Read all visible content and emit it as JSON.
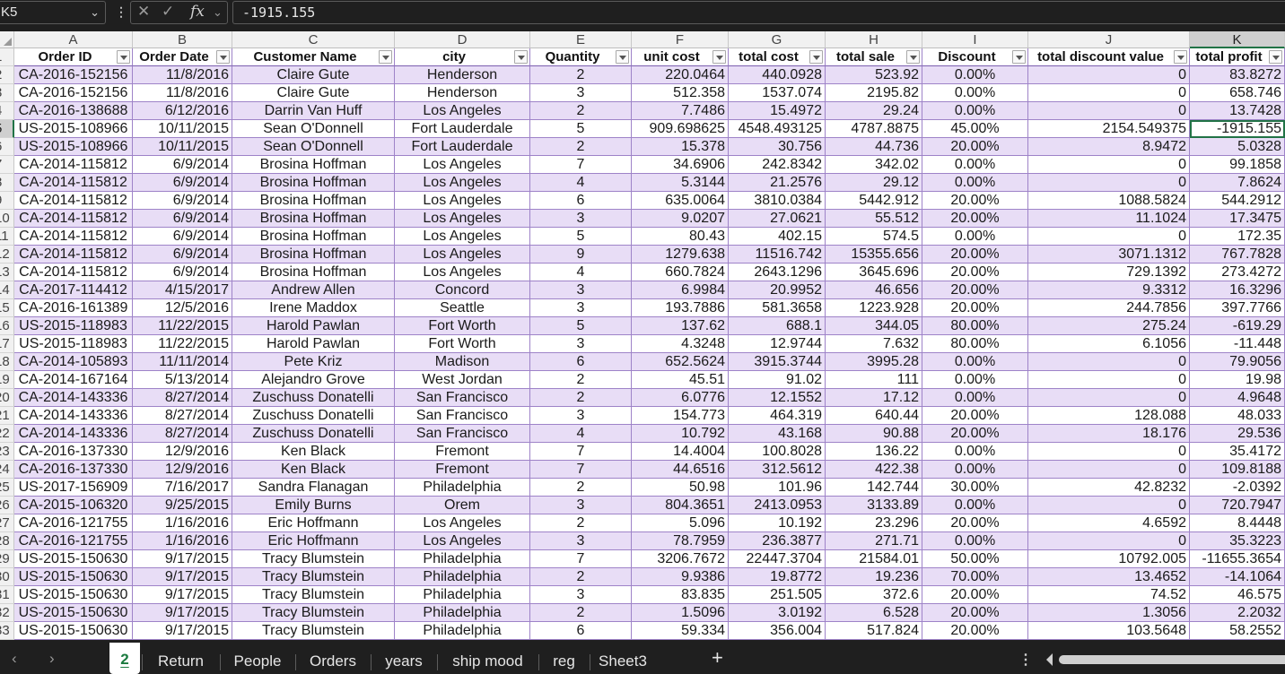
{
  "formula_bar": {
    "name_box": "K5",
    "menu_glyph": "⋮",
    "cancel_glyph": "✕",
    "enter_glyph": "✓",
    "fx_glyph": "fx",
    "formula": "-1915.155"
  },
  "columns": [
    "A",
    "B",
    "C",
    "D",
    "E",
    "F",
    "G",
    "H",
    "I",
    "J",
    "K"
  ],
  "selected_column": "K",
  "header_row_number": "1",
  "headers": [
    "Order ID",
    "Order Date",
    "Customer Name",
    "city",
    "Quantity",
    "unit cost",
    "total cost",
    "total sale",
    "Discount",
    "total discount value",
    "total profit"
  ],
  "rows": [
    {
      "n": "2",
      "v": [
        "CA-2016-152156",
        "11/8/2016",
        "Claire Gute",
        "Henderson",
        "2",
        "220.0464",
        "440.0928",
        "523.92",
        "0.00%",
        "0",
        "83.8272"
      ]
    },
    {
      "n": "3",
      "v": [
        "CA-2016-152156",
        "11/8/2016",
        "Claire Gute",
        "Henderson",
        "3",
        "512.358",
        "1537.074",
        "2195.82",
        "0.00%",
        "0",
        "658.746"
      ]
    },
    {
      "n": "4",
      "v": [
        "CA-2016-138688",
        "6/12/2016",
        "Darrin Van Huff",
        "Los Angeles",
        "2",
        "7.7486",
        "15.4972",
        "29.24",
        "0.00%",
        "0",
        "13.7428"
      ]
    },
    {
      "n": "5",
      "v": [
        "US-2015-108966",
        "10/11/2015",
        "Sean O'Donnell",
        "Fort Lauderdale",
        "5",
        "909.698625",
        "4548.493125",
        "4787.8875",
        "45.00%",
        "2154.549375",
        "-1915.155"
      ]
    },
    {
      "n": "6",
      "v": [
        "US-2015-108966",
        "10/11/2015",
        "Sean O'Donnell",
        "Fort Lauderdale",
        "2",
        "15.378",
        "30.756",
        "44.736",
        "20.00%",
        "8.9472",
        "5.0328"
      ]
    },
    {
      "n": "7",
      "v": [
        "CA-2014-115812",
        "6/9/2014",
        "Brosina Hoffman",
        "Los Angeles",
        "7",
        "34.6906",
        "242.8342",
        "342.02",
        "0.00%",
        "0",
        "99.1858"
      ]
    },
    {
      "n": "8",
      "v": [
        "CA-2014-115812",
        "6/9/2014",
        "Brosina Hoffman",
        "Los Angeles",
        "4",
        "5.3144",
        "21.2576",
        "29.12",
        "0.00%",
        "0",
        "7.8624"
      ]
    },
    {
      "n": "9",
      "v": [
        "CA-2014-115812",
        "6/9/2014",
        "Brosina Hoffman",
        "Los Angeles",
        "6",
        "635.0064",
        "3810.0384",
        "5442.912",
        "20.00%",
        "1088.5824",
        "544.2912"
      ]
    },
    {
      "n": "10",
      "v": [
        "CA-2014-115812",
        "6/9/2014",
        "Brosina Hoffman",
        "Los Angeles",
        "3",
        "9.0207",
        "27.0621",
        "55.512",
        "20.00%",
        "11.1024",
        "17.3475"
      ]
    },
    {
      "n": "11",
      "v": [
        "CA-2014-115812",
        "6/9/2014",
        "Brosina Hoffman",
        "Los Angeles",
        "5",
        "80.43",
        "402.15",
        "574.5",
        "0.00%",
        "0",
        "172.35"
      ]
    },
    {
      "n": "12",
      "v": [
        "CA-2014-115812",
        "6/9/2014",
        "Brosina Hoffman",
        "Los Angeles",
        "9",
        "1279.638",
        "11516.742",
        "15355.656",
        "20.00%",
        "3071.1312",
        "767.7828"
      ]
    },
    {
      "n": "13",
      "v": [
        "CA-2014-115812",
        "6/9/2014",
        "Brosina Hoffman",
        "Los Angeles",
        "4",
        "660.7824",
        "2643.1296",
        "3645.696",
        "20.00%",
        "729.1392",
        "273.4272"
      ]
    },
    {
      "n": "14",
      "v": [
        "CA-2017-114412",
        "4/15/2017",
        "Andrew Allen",
        "Concord",
        "3",
        "6.9984",
        "20.9952",
        "46.656",
        "20.00%",
        "9.3312",
        "16.3296"
      ]
    },
    {
      "n": "15",
      "v": [
        "CA-2016-161389",
        "12/5/2016",
        "Irene Maddox",
        "Seattle",
        "3",
        "193.7886",
        "581.3658",
        "1223.928",
        "20.00%",
        "244.7856",
        "397.7766"
      ]
    },
    {
      "n": "16",
      "v": [
        "US-2015-118983",
        "11/22/2015",
        "Harold Pawlan",
        "Fort Worth",
        "5",
        "137.62",
        "688.1",
        "344.05",
        "80.00%",
        "275.24",
        "-619.29"
      ]
    },
    {
      "n": "17",
      "v": [
        "US-2015-118983",
        "11/22/2015",
        "Harold Pawlan",
        "Fort Worth",
        "3",
        "4.3248",
        "12.9744",
        "7.632",
        "80.00%",
        "6.1056",
        "-11.448"
      ]
    },
    {
      "n": "18",
      "v": [
        "CA-2014-105893",
        "11/11/2014",
        "Pete Kriz",
        "Madison",
        "6",
        "652.5624",
        "3915.3744",
        "3995.28",
        "0.00%",
        "0",
        "79.9056"
      ]
    },
    {
      "n": "19",
      "v": [
        "CA-2014-167164",
        "5/13/2014",
        "Alejandro Grove",
        "West Jordan",
        "2",
        "45.51",
        "91.02",
        "111",
        "0.00%",
        "0",
        "19.98"
      ]
    },
    {
      "n": "20",
      "v": [
        "CA-2014-143336",
        "8/27/2014",
        "Zuschuss Donatelli",
        "San Francisco",
        "2",
        "6.0776",
        "12.1552",
        "17.12",
        "0.00%",
        "0",
        "4.9648"
      ]
    },
    {
      "n": "21",
      "v": [
        "CA-2014-143336",
        "8/27/2014",
        "Zuschuss Donatelli",
        "San Francisco",
        "3",
        "154.773",
        "464.319",
        "640.44",
        "20.00%",
        "128.088",
        "48.033"
      ]
    },
    {
      "n": "22",
      "v": [
        "CA-2014-143336",
        "8/27/2014",
        "Zuschuss Donatelli",
        "San Francisco",
        "4",
        "10.792",
        "43.168",
        "90.88",
        "20.00%",
        "18.176",
        "29.536"
      ]
    },
    {
      "n": "23",
      "v": [
        "CA-2016-137330",
        "12/9/2016",
        "Ken Black",
        "Fremont",
        "7",
        "14.4004",
        "100.8028",
        "136.22",
        "0.00%",
        "0",
        "35.4172"
      ]
    },
    {
      "n": "24",
      "v": [
        "CA-2016-137330",
        "12/9/2016",
        "Ken Black",
        "Fremont",
        "7",
        "44.6516",
        "312.5612",
        "422.38",
        "0.00%",
        "0",
        "109.8188"
      ]
    },
    {
      "n": "25",
      "v": [
        "US-2017-156909",
        "7/16/2017",
        "Sandra Flanagan",
        "Philadelphia",
        "2",
        "50.98",
        "101.96",
        "142.744",
        "30.00%",
        "42.8232",
        "-2.0392"
      ]
    },
    {
      "n": "26",
      "v": [
        "CA-2015-106320",
        "9/25/2015",
        "Emily Burns",
        "Orem",
        "3",
        "804.3651",
        "2413.0953",
        "3133.89",
        "0.00%",
        "0",
        "720.7947"
      ]
    },
    {
      "n": "27",
      "v": [
        "CA-2016-121755",
        "1/16/2016",
        "Eric Hoffmann",
        "Los Angeles",
        "2",
        "5.096",
        "10.192",
        "23.296",
        "20.00%",
        "4.6592",
        "8.4448"
      ]
    },
    {
      "n": "28",
      "v": [
        "CA-2016-121755",
        "1/16/2016",
        "Eric Hoffmann",
        "Los Angeles",
        "3",
        "78.7959",
        "236.3877",
        "271.71",
        "0.00%",
        "0",
        "35.3223"
      ]
    },
    {
      "n": "29",
      "v": [
        "US-2015-150630",
        "9/17/2015",
        "Tracy Blumstein",
        "Philadelphia",
        "7",
        "3206.7672",
        "22447.3704",
        "21584.01",
        "50.00%",
        "10792.005",
        "-11655.3654"
      ]
    },
    {
      "n": "30",
      "v": [
        "US-2015-150630",
        "9/17/2015",
        "Tracy Blumstein",
        "Philadelphia",
        "2",
        "9.9386",
        "19.8772",
        "19.236",
        "70.00%",
        "13.4652",
        "-14.1064"
      ]
    },
    {
      "n": "31",
      "v": [
        "US-2015-150630",
        "9/17/2015",
        "Tracy Blumstein",
        "Philadelphia",
        "3",
        "83.835",
        "251.505",
        "372.6",
        "20.00%",
        "74.52",
        "46.575"
      ]
    },
    {
      "n": "32",
      "v": [
        "US-2015-150630",
        "9/17/2015",
        "Tracy Blumstein",
        "Philadelphia",
        "2",
        "1.5096",
        "3.0192",
        "6.528",
        "20.00%",
        "1.3056",
        "2.2032"
      ]
    },
    {
      "n": "33",
      "v": [
        "US-2015-150630",
        "9/17/2015",
        "Tracy Blumstein",
        "Philadelphia",
        "6",
        "59.334",
        "356.004",
        "517.824",
        "20.00%",
        "103.5648",
        "58.2552"
      ]
    }
  ],
  "active_cell": {
    "row": "5",
    "column": "K"
  },
  "sheet_tabs": [
    "2",
    "Return",
    "People",
    "Orders",
    "years",
    "ship mood",
    "reg",
    "Sheet3"
  ],
  "active_sheet": "2",
  "tabbar_glyphs": {
    "prev": "‹",
    "next": "›",
    "add": "+",
    "menu": "⋮"
  },
  "colors": {
    "band": "#e8ddf6",
    "table_border": "#9e83c8",
    "selection": "#217346"
  }
}
